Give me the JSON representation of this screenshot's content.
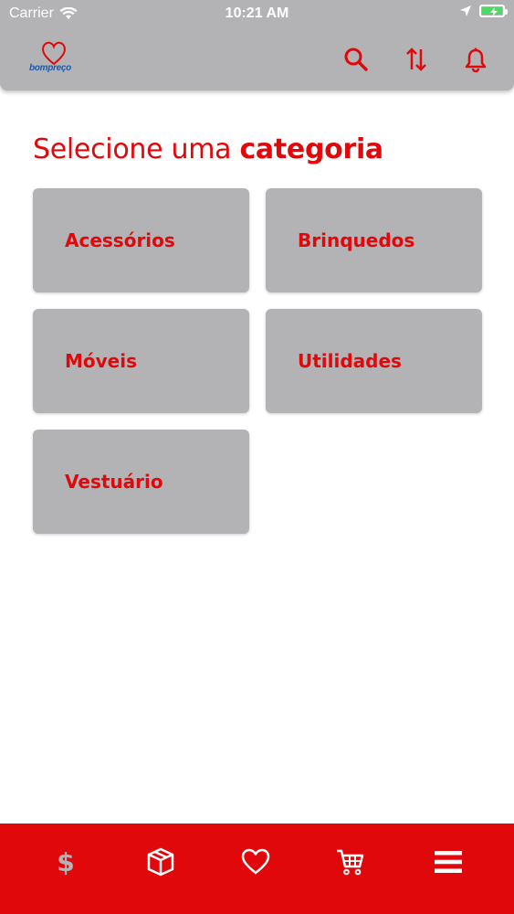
{
  "status_bar": {
    "carrier": "Carrier",
    "time": "10:21 AM"
  },
  "header": {
    "logo_text": "bompreço",
    "icons": [
      "search-icon",
      "sort-icon",
      "bell-icon"
    ]
  },
  "page": {
    "title_regular": "Selecione uma ",
    "title_bold": "categoria"
  },
  "categories": [
    {
      "label": "Acessórios"
    },
    {
      "label": "Brinquedos"
    },
    {
      "label": "Móveis"
    },
    {
      "label": "Utilidades"
    },
    {
      "label": "Vestuário"
    }
  ],
  "bottom_nav": {
    "dollar_symbol": "$",
    "items": [
      "dollar-icon",
      "package-icon",
      "heart-icon",
      "cart-icon",
      "menu-icon"
    ]
  },
  "colors": {
    "accent": "#e0080b",
    "header_bg": "#b3b3b5",
    "card_bg": "#b3b3b5",
    "battery": "#4cd964",
    "logo_blue": "#1f5aa6"
  }
}
